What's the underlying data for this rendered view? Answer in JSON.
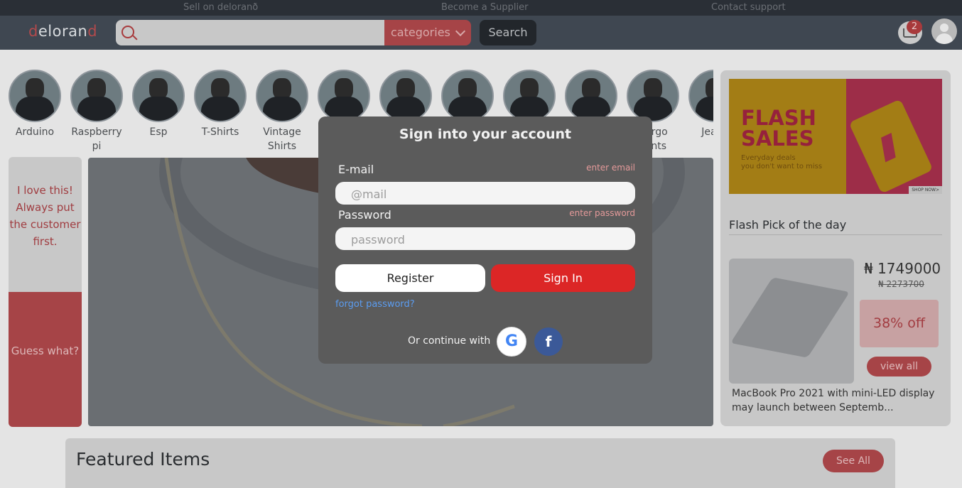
{
  "topbar": {
    "links": [
      "Sell on deloranð",
      "Become a Supplier",
      "Contact support"
    ]
  },
  "header": {
    "logo_prefix": "d",
    "logo_main": "eloran",
    "logo_suffix": "d",
    "search_placeholder": "",
    "categories_label": "categories",
    "search_button": "Search",
    "cart_count": "2"
  },
  "categories": [
    {
      "label": "Arduino"
    },
    {
      "label": "Raspberry pi"
    },
    {
      "label": "Esp"
    },
    {
      "label": "T-Shirts"
    },
    {
      "label": "Vintage Shirts"
    },
    {
      "label": ""
    },
    {
      "label": ""
    },
    {
      "label": ""
    },
    {
      "label": ""
    },
    {
      "label": ""
    },
    {
      "label": "Cargo Pants"
    },
    {
      "label": "Jeans"
    }
  ],
  "testimonial": {
    "quote": "I love this! Always put the customer first.",
    "cta": "Guess what?"
  },
  "flash": {
    "banner_line1": "FLASH",
    "banner_line2": "SALES",
    "banner_sub1": "Everyday deals",
    "banner_sub2": "you don't want to miss",
    "banner_shop": "SHOP NOW>",
    "pick_title": "Flash Pick of the day",
    "price": "₦ 1749000",
    "old_price": "₦ 2273700",
    "discount": "38% off",
    "view_all": "view all",
    "description": "MacBook Pro 2021 with mini-LED display may launch between Septemb..."
  },
  "featured": {
    "title": "Featured Items",
    "see_all": "See All"
  },
  "modal": {
    "title": "Sign into your account",
    "email_label": "E-mail",
    "email_hint": "enter email",
    "email_placeholder": "@mail",
    "password_label": "Password",
    "password_hint": "enter password",
    "password_placeholder": "password",
    "register": "Register",
    "signin": "Sign In",
    "forgot": "forgot password?",
    "continue_with": "Or continue with",
    "google_icon": "G",
    "facebook_icon": "f"
  },
  "colors": {
    "accent": "#dc2626",
    "brand": "#a64447"
  }
}
